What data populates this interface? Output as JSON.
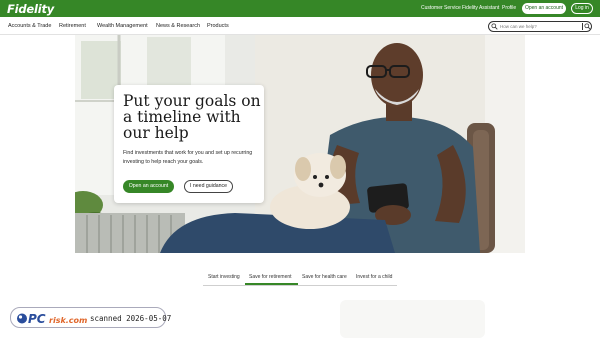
{
  "brand": {
    "logo": "Fidelity",
    "accent": "#368727"
  },
  "utility": {
    "links": [
      "Customer Service",
      "Fidelity Assistant",
      "Profile"
    ],
    "open_account": "Open an account",
    "login": "Log in"
  },
  "nav": {
    "items": [
      "Accounts & Trade",
      "Retirement",
      "Wealth Management",
      "News & Research",
      "Products"
    ]
  },
  "search": {
    "placeholder": "How can we help?",
    "icon": "search-icon"
  },
  "hero": {
    "title": "Put your goals on a timeline with our help",
    "body": "Find investments that work for you and set up recurring investing to help reach your goals.",
    "primary_button": "Open an account",
    "secondary_button": "I need guidance"
  },
  "tabs": {
    "items": [
      "Start investing",
      "Save for retirement",
      "Save for health care",
      "Invest for a child"
    ],
    "active_index": 1
  },
  "watermark": {
    "logo_text": "PCrisk.com",
    "scanned": "scanned 2026-05-07"
  }
}
